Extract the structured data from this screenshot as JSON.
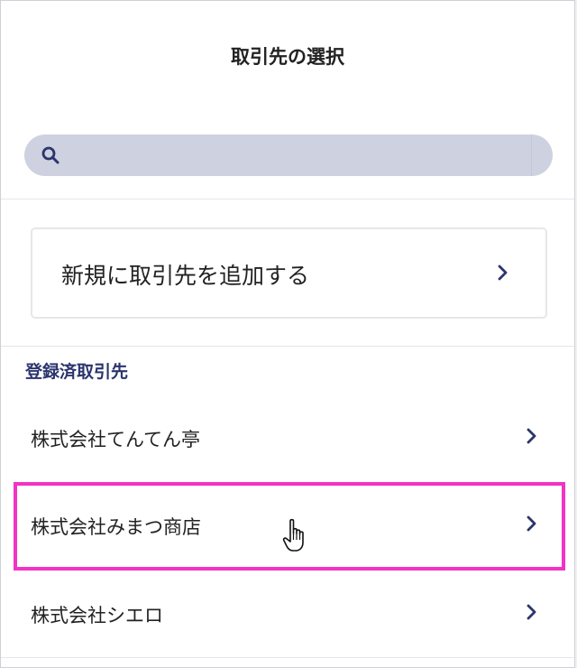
{
  "dialog": {
    "title": "取引先の選択"
  },
  "search": {
    "icon": "search-icon",
    "value": ""
  },
  "add_new": {
    "label": "新規に取引先を追加する",
    "icon": "chevron-right-icon"
  },
  "registered": {
    "heading": "登録済取引先",
    "items": [
      {
        "label": "株式会社てんてん亭",
        "icon": "chevron-right-icon"
      },
      {
        "label": "株式会社みまつ商店",
        "icon": "chevron-right-icon",
        "highlighted": true
      },
      {
        "label": "株式会社シエロ",
        "icon": "chevron-right-icon"
      }
    ]
  },
  "colors": {
    "accent_navy": "#2b356d",
    "search_bg": "#ced1df",
    "highlight_magenta": "#f233c4"
  }
}
